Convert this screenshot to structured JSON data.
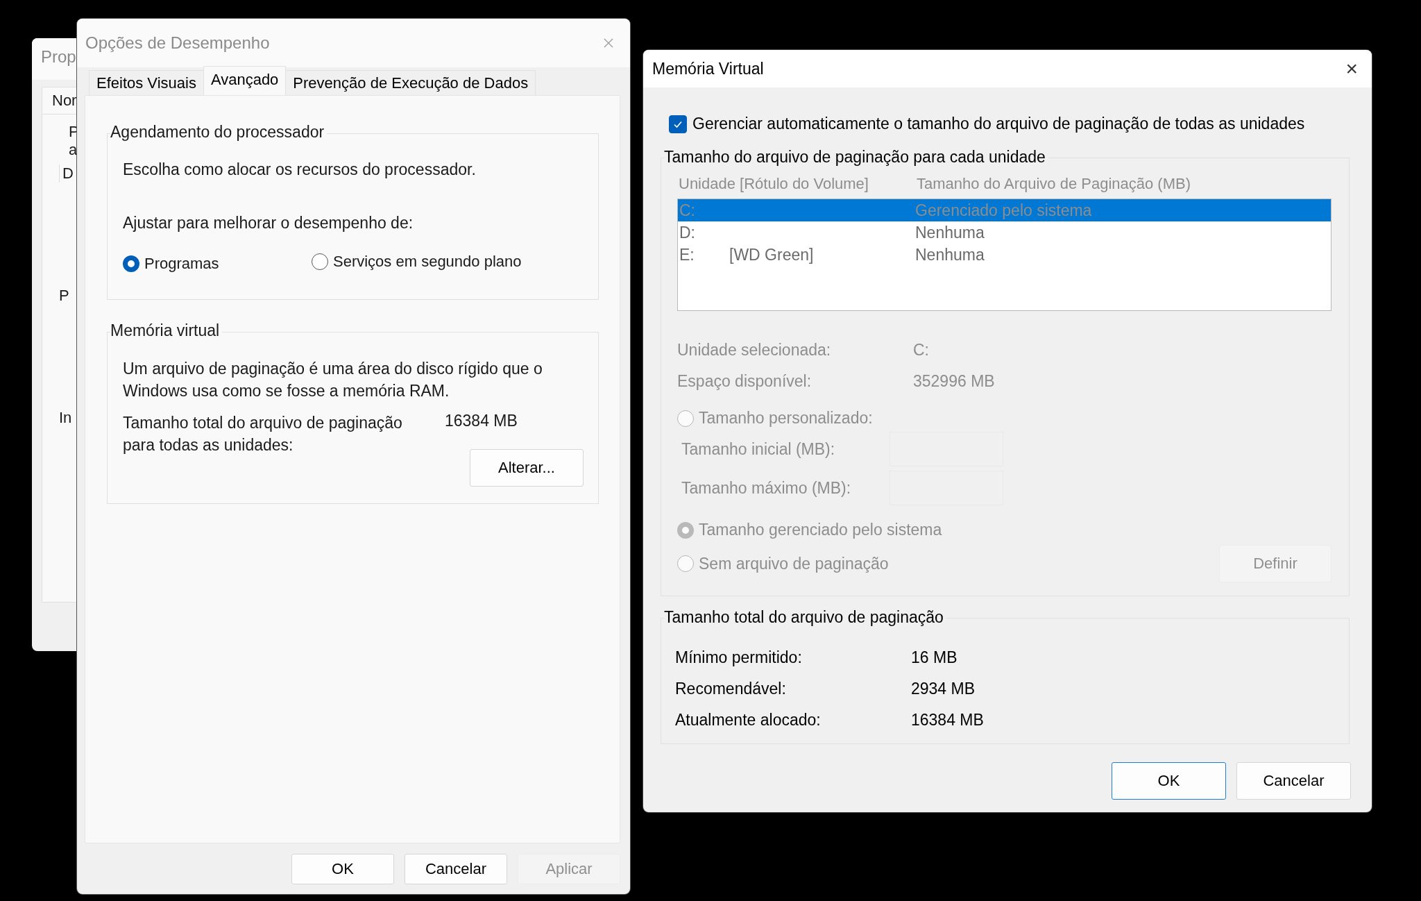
{
  "background_window": {
    "title": "Prop",
    "tab": "Nor",
    "texts": [
      "P",
      "a",
      "D",
      "P",
      "In"
    ]
  },
  "performance_options": {
    "title": "Opções de Desempenho",
    "active": false,
    "tabs": [
      {
        "label": "Efeitos Visuais",
        "selected": false
      },
      {
        "label": "Avançado",
        "selected": true
      },
      {
        "label": "Prevenção de Execução de Dados",
        "selected": false
      }
    ],
    "processor_scheduling": {
      "title": "Agendamento do processador",
      "description": "Escolha como alocar os recursos do processador.",
      "adjust_label": "Ajustar para melhorar o desempenho de:",
      "options": [
        {
          "label": "Programas",
          "selected": true
        },
        {
          "label": "Serviços em segundo plano",
          "selected": false
        }
      ]
    },
    "virtual_memory": {
      "title": "Memória virtual",
      "description": "Um arquivo de paginação é uma área do disco rígido que o Windows usa como se fosse a memória RAM.",
      "total_label": "Tamanho total do arquivo de paginação para todas as unidades:",
      "total_value": "16384 MB",
      "change_button": "Alterar..."
    },
    "buttons": [
      {
        "label": "OK",
        "disabled": false
      },
      {
        "label": "Cancelar",
        "disabled": false
      },
      {
        "label": "Aplicar",
        "disabled": true
      }
    ]
  },
  "virtual_memory_dialog": {
    "title": "Memória Virtual",
    "close": "×",
    "auto_manage": {
      "label": "Gerenciar automaticamente o tamanho do arquivo de paginação de todas as unidades",
      "checked": true
    },
    "per_drive": {
      "title": "Tamanho do arquivo de paginação para cada unidade",
      "disabled": true,
      "columns": [
        "Unidade [Rótulo do Volume]",
        "Tamanho do Arquivo de Paginação (MB)"
      ],
      "drives": [
        {
          "drive": "C:",
          "size": "Gerenciado pelo sistema",
          "selected": true
        },
        {
          "drive": "D:",
          "size": "Nenhuma",
          "selected": false
        },
        {
          "drive": "E:",
          "label": "[WD Green]",
          "size": "Nenhuma",
          "selected": false
        }
      ],
      "info": [
        {
          "label": "Unidade selecionada:",
          "value": "C:"
        },
        {
          "label": "Espaço disponível:",
          "value": "352996 MB"
        }
      ],
      "size_options": [
        {
          "kind": "custom",
          "label": "Tamanho personalizado:",
          "selected": false,
          "fields": [
            {
              "label": "Tamanho inicial (MB):"
            },
            {
              "label": "Tamanho máximo (MB):"
            }
          ]
        },
        {
          "kind": "plain",
          "label": "Tamanho gerenciado pelo sistema",
          "selected": true
        },
        {
          "kind": "set",
          "label": "Sem arquivo de paginação",
          "selected": false,
          "button": "Definir"
        }
      ]
    },
    "totals": {
      "title": "Tamanho total do arquivo de paginação",
      "rows": [
        {
          "label": "Mínimo permitido:",
          "value": "16 MB"
        },
        {
          "label": "Recomendável:",
          "value": "2934 MB"
        },
        {
          "label": "Atualmente alocado:",
          "value": "16384 MB"
        }
      ]
    },
    "buttons": [
      {
        "label": "OK",
        "default": true
      },
      {
        "label": "Cancelar",
        "default": false
      }
    ]
  }
}
